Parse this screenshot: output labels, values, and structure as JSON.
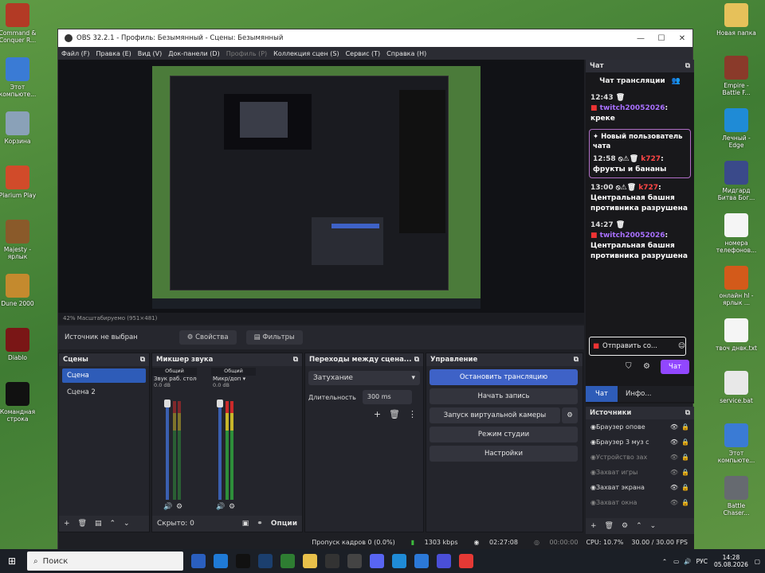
{
  "desktop_icons_left": [
    {
      "label": "Command & Conquer R...",
      "color": "#b33a25"
    },
    {
      "label": "Этот компьюте...",
      "color": "#3a7bd5"
    },
    {
      "label": "Корзина",
      "color": "#8aa1b8"
    },
    {
      "label": "Plarium Play",
      "color": "#d14b2a"
    },
    {
      "label": "Majesty - ярлык",
      "color": "#8a5a2a"
    },
    {
      "label": "Dune 2000",
      "color": "#c48a2e"
    },
    {
      "label": "Diablo",
      "color": "#7a1616"
    },
    {
      "label": "Командная строка",
      "color": "#111111"
    }
  ],
  "desktop_icons_right": [
    {
      "label": "Новая папка",
      "color": "#e6c15a"
    },
    {
      "label": "Empire - Battle F...",
      "color": "#8a3a2a"
    },
    {
      "label": "Лечный - Edge",
      "color": "#1f8bd6"
    },
    {
      "label": "Мидгард Битва Бог...",
      "color": "#3a4a8a"
    },
    {
      "label": "номера телефонов...",
      "color": "#f5f5f5"
    },
    {
      "label": "онлайн hl - ярлык ...",
      "color": "#d35a1a"
    },
    {
      "label": "твоч днвк.txt",
      "color": "#f5f5f5"
    },
    {
      "label": "service.bat",
      "color": "#e8e8e8"
    },
    {
      "label": "Этот компьюте...",
      "color": "#3a7bd5"
    },
    {
      "label": "Battle Chaser...",
      "color": "#666a70"
    }
  ],
  "window": {
    "title": "OBS 32.2.1 - Профиль: Безымянный - Сцены: Безымянный",
    "minimize": "—",
    "maximize": "☐",
    "close": "✕"
  },
  "menu": [
    "Файл (F)",
    "Правка (E)",
    "Вид (V)",
    "Док-панели (D)",
    "Профиль (P)",
    "Коллекция сцен (S)",
    "Сервис (T)",
    "Справка (H)"
  ],
  "preview_bar": "42%    Масштабируемо (951×481)",
  "source_toolbar": {
    "no_source": "Источник не выбран",
    "properties": "Свойства",
    "filters": "Фильтры"
  },
  "scenes": {
    "title": "Сцены",
    "items": [
      "Сцена",
      "Сцена 2"
    ],
    "selected": 0
  },
  "mixer": {
    "title": "Микшер звука",
    "channels": [
      {
        "name": "Общий",
        "label": "Звук раб. столе",
        "db": "0.0 dB",
        "fader": 0.95,
        "level": 0.0
      },
      {
        "name": "Общий",
        "label": "Микр/доп",
        "db": "0.0 dB",
        "fader": 0.95,
        "level": 0.55
      }
    ],
    "footer_hide": "Скрыто: 0",
    "options": "Опции"
  },
  "transitions": {
    "title": "Переходы между сцена...",
    "type": "Затухание",
    "duration_label": "Длительность",
    "duration_value": "300 ms"
  },
  "controls": {
    "title": "Управление",
    "buttons": [
      "Остановить трансляцию",
      "Начать запись",
      "Запуск виртуальной камеры",
      "Режим студии",
      "Настройки"
    ]
  },
  "chat": {
    "header": "Чат",
    "title": "Чат трансляции",
    "messages": [
      {
        "time": "12:43",
        "user": "twitch20052026",
        "text": "креке",
        "user_color": "#a970ff"
      },
      {
        "time": "12:58",
        "user": "k727",
        "text": "фрукты и бананы",
        "user_color": "#ff4646"
      },
      {
        "time": "13:00",
        "user": "k727",
        "text": "Центральная башня противника разрушена",
        "user_color": "#ff4646"
      },
      {
        "time": "14:27",
        "user": "twitch20052026",
        "text": "Центральная башня противника разрушена",
        "user_color": "#a970ff"
      }
    ],
    "new_user": "Новый пользователь чата",
    "send_label": "Отправить со...",
    "chat_button": "Чат",
    "tabs": [
      "Чат",
      "Инфо..."
    ]
  },
  "sources": {
    "title": "Источники",
    "items": [
      {
        "name": "Браузер опове",
        "dim": false
      },
      {
        "name": "Браузер 3 муз с",
        "dim": false
      },
      {
        "name": "Устройство зах",
        "dim": true
      },
      {
        "name": "Захват игры",
        "dim": true
      },
      {
        "name": "Захват экрана",
        "dim": false
      },
      {
        "name": "Захват окна",
        "dim": true
      }
    ]
  },
  "status": {
    "dropped": "Пропуск кадров 0 (0.0%)",
    "bitrate": "1303 kbps",
    "stream_time": "02:27:08",
    "rec_time": "00:00:00",
    "cpu": "CPU: 10.7%",
    "fps": "30.00 / 30.00 FPS"
  },
  "taskbar": {
    "search_placeholder": "Поиск",
    "lang": "РУС",
    "time": "14:28",
    "date": "05.08.2026"
  }
}
